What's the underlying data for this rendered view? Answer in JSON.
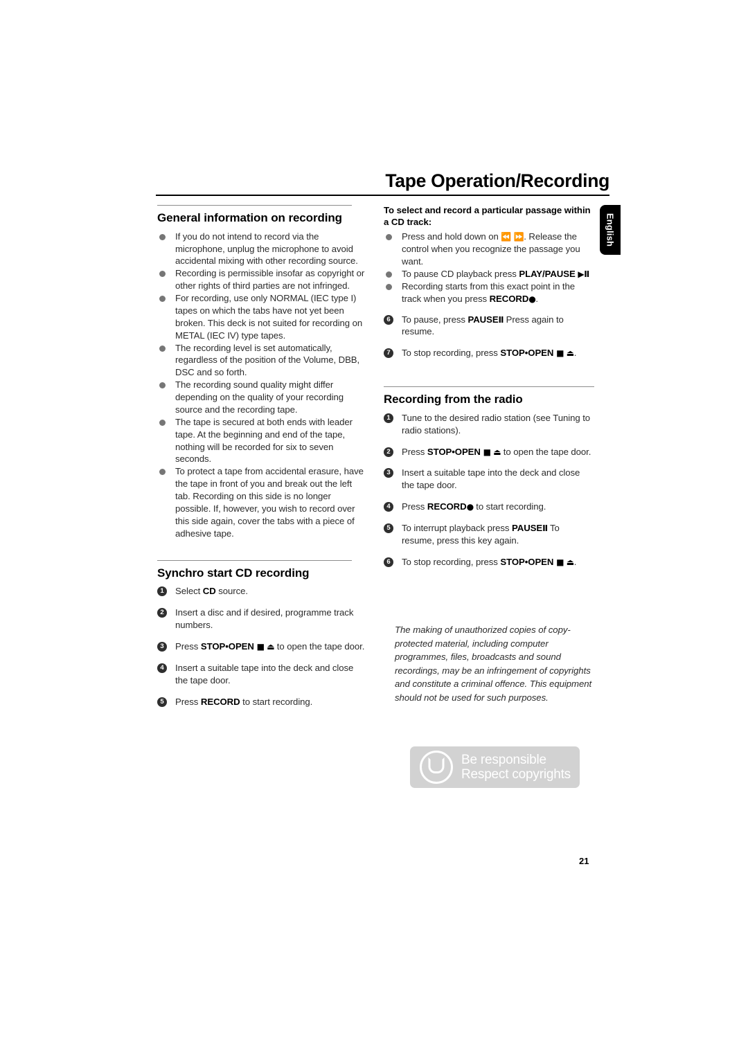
{
  "header": {
    "title": "Tape Operation/Recording",
    "language_tab": "English"
  },
  "page_number": "21",
  "left_column": {
    "section1": {
      "title": "General information on recording",
      "bullets": [
        "If you do not intend to record via the microphone, unplug the microphone to avoid accidental mixing with other recording source.",
        "Recording is permissible insofar as copyright or other rights of third parties are not infringed.",
        "For recording, use only NORMAL (IEC type I) tapes on which the tabs have not yet been broken. This deck is not suited for recording on METAL (IEC IV) type tapes.",
        "The recording level is set automatically, regardless of the position of the Volume, DBB, DSC and so forth.",
        "The recording sound quality might differ depending on the quality of your recording source and the recording tape.",
        "The tape is secured at both ends with leader tape.  At the beginning and end of the tape, nothing will be recorded for six to seven seconds.",
        "To protect a tape from accidental erasure, have the tape in front of you and break out the left tab. Recording on this side is no longer possible. If, however, you wish to record over this side again, cover the tabs with a piece of adhesive tape."
      ]
    },
    "section2": {
      "title": "Synchro start CD recording",
      "steps": [
        {
          "n": "1",
          "pre": "Select ",
          "kb": "CD",
          "post": " source.",
          "sym": ""
        },
        {
          "n": "2",
          "pre": "Insert a disc and if desired, programme track numbers.",
          "kb": "",
          "post": "",
          "sym": ""
        },
        {
          "n": "3",
          "pre": "Press ",
          "kb": "STOP•OPEN",
          "sym": " ■ ⏏",
          "post": " to open the tape door."
        },
        {
          "n": "4",
          "pre": "Insert a suitable tape into the deck and close the tape door.",
          "kb": "",
          "post": "",
          "sym": ""
        },
        {
          "n": "5",
          "pre": "Press ",
          "kb": "RECORD",
          "sym": "",
          "post": " to start recording."
        }
      ]
    }
  },
  "right_column": {
    "section1": {
      "title": "To select and record a particular passage within a CD track:",
      "bullets": [
        {
          "pre": "Press and hold down on ",
          "sym": "⏪  ⏩",
          "post": ". Release the control when you recognize the passage you want.",
          "kb": ""
        },
        {
          "pre": "To pause CD playback press ",
          "kb": "PLAY/PAUSE",
          "sym": " ▶Ⅱ",
          "post": ""
        },
        {
          "pre": "Recording starts from this exact point in the track when you press ",
          "kb": "RECORD",
          "sym": "●",
          "post": "."
        }
      ],
      "steps": [
        {
          "n": "6",
          "pre": "To pause, press ",
          "kb": "PAUSE",
          "sym": "Ⅱ",
          "post": " Press again to resume."
        },
        {
          "n": "7",
          "pre": "To stop recording, press ",
          "kb": "STOP•OPEN",
          "sym": " ■ ⏏",
          "post": "."
        }
      ]
    },
    "section2": {
      "title": "Recording from the radio",
      "steps": [
        {
          "n": "1",
          "pre": "Tune to the desired radio station (see Tuning to radio stations).",
          "kb": "",
          "sym": "",
          "post": ""
        },
        {
          "n": "2",
          "pre": "Press ",
          "kb": "STOP•OPEN",
          "sym": " ■ ⏏",
          "post": " to open the tape door."
        },
        {
          "n": "3",
          "pre": "Insert a suitable tape into the deck and close the tape door.",
          "kb": "",
          "sym": "",
          "post": ""
        },
        {
          "n": "4",
          "pre": "Press ",
          "kb": "RECORD",
          "sym": "●",
          "post": " to start recording."
        },
        {
          "n": "5",
          "pre": "To interrupt playback press ",
          "kb": "PAUSE",
          "sym": "Ⅱ",
          "post": " To resume, press this key again."
        },
        {
          "n": "6",
          "pre": "To stop recording, press ",
          "kb": "STOP•OPEN",
          "sym": " ■ ⏏",
          "post": "."
        }
      ]
    },
    "copyright_note": "The making of unauthorized copies of copy-protected material, including computer programmes, files, broadcasts and sound recordings, may be an infringement of copyrights and constitute a criminal offence. This equipment should not be used for such purposes.",
    "badge": {
      "line1": "Be responsible",
      "line2": "Respect copyrights",
      "bg_color": "#d2d2d2",
      "text_color": "#ffffff"
    }
  },
  "colors": {
    "text": "#2b2b2b",
    "heading": "#000000",
    "bullet": "#767676",
    "step_circle": "#2f2f2f",
    "rule": "#8c8c8c",
    "title_rule": "#000000"
  }
}
